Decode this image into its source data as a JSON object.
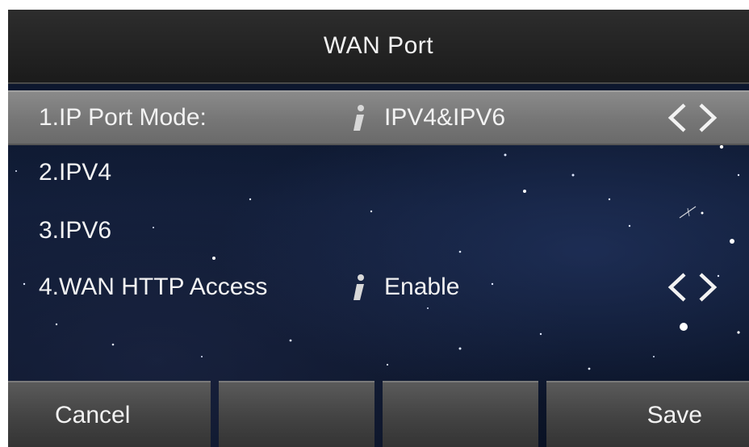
{
  "header": {
    "title": "WAN Port"
  },
  "menu": {
    "items": [
      {
        "label": "1.IP Port Mode:",
        "value": "IPV4&IPV6",
        "info": true,
        "arrows": true,
        "selected": true
      },
      {
        "label": "2.IPV4"
      },
      {
        "label": "3.IPV6"
      },
      {
        "label": "4.WAN HTTP Access",
        "value": "Enable",
        "info": true,
        "arrows": true
      }
    ]
  },
  "softkeys": {
    "key1": "Cancel",
    "key2": "",
    "key3": "",
    "key4": "Save"
  },
  "icons": {
    "info": "info-icon",
    "left": "chevron-left-icon",
    "right": "chevron-right-icon"
  },
  "colors": {
    "header": "#232323",
    "selected_row": "#7a7a7a",
    "background": "#0e1830",
    "text": "#f2f2f2"
  }
}
